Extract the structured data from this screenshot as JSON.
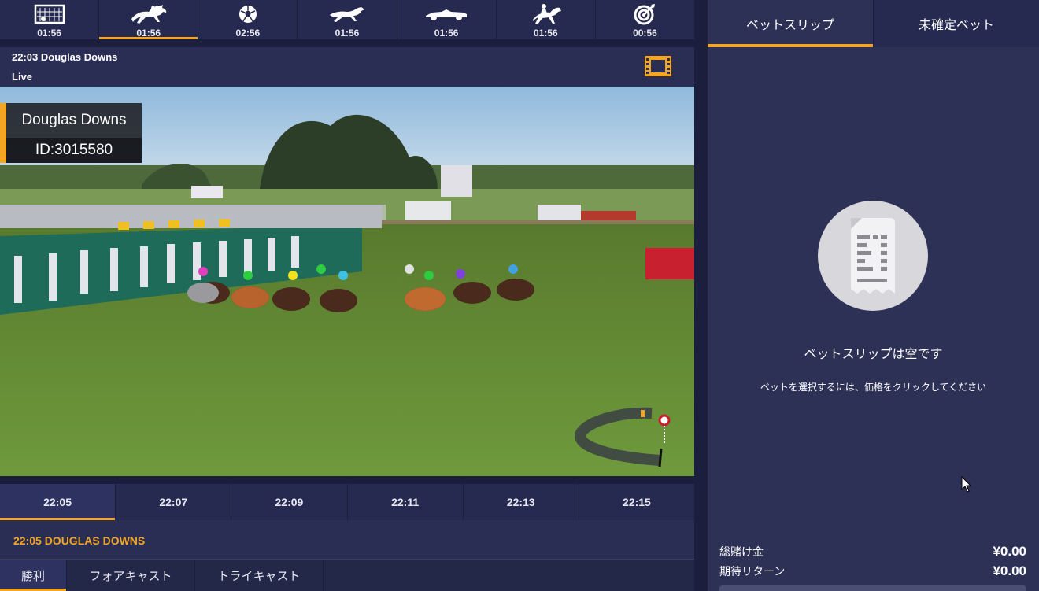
{
  "sports_bar": {
    "tabs": [
      {
        "icon": "soccer-goal-icon",
        "time": "01:56",
        "active": false
      },
      {
        "icon": "horse-racing-icon",
        "time": "01:56",
        "active": true
      },
      {
        "icon": "football-icon",
        "time": "02:56",
        "active": false
      },
      {
        "icon": "greyhound-icon",
        "time": "01:56",
        "active": false
      },
      {
        "icon": "race-car-icon",
        "time": "01:56",
        "active": false
      },
      {
        "icon": "harness-racing-icon",
        "time": "01:56",
        "active": false
      },
      {
        "icon": "darts-target-icon",
        "time": "00:56",
        "active": false
      }
    ]
  },
  "event": {
    "title": "22:03 Douglas Downs",
    "status": "Live",
    "video_icon": "video-film-icon"
  },
  "video_overlay": {
    "track_name": "Douglas Downs",
    "race_id": "ID:3015580"
  },
  "race_times": {
    "items": [
      "22:05",
      "22:07",
      "22:09",
      "22:11",
      "22:13",
      "22:15"
    ],
    "active_index": 0
  },
  "race": {
    "title": "22:05 DOUGLAS DOWNS"
  },
  "bet_types": {
    "tabs": [
      "勝利",
      "フォアキャスト",
      "トライキャスト"
    ],
    "active_index": 0
  },
  "bet_slip": {
    "tabs": [
      "ベットスリップ",
      "未確定ベット"
    ],
    "active_index": 0,
    "empty_icon": "receipt-icon",
    "empty_title": "ベットスリップは空です",
    "empty_hint": "ベットを選択するには、価格をクリックしてください",
    "total_stake_label": "総賭け金",
    "total_stake_value": "¥0.00",
    "expected_return_label": "期待リターン",
    "expected_return_value": "¥0.00"
  },
  "colors": {
    "accent": "#f4a623",
    "panel": "#2d3156",
    "background": "#1b1e3d"
  }
}
